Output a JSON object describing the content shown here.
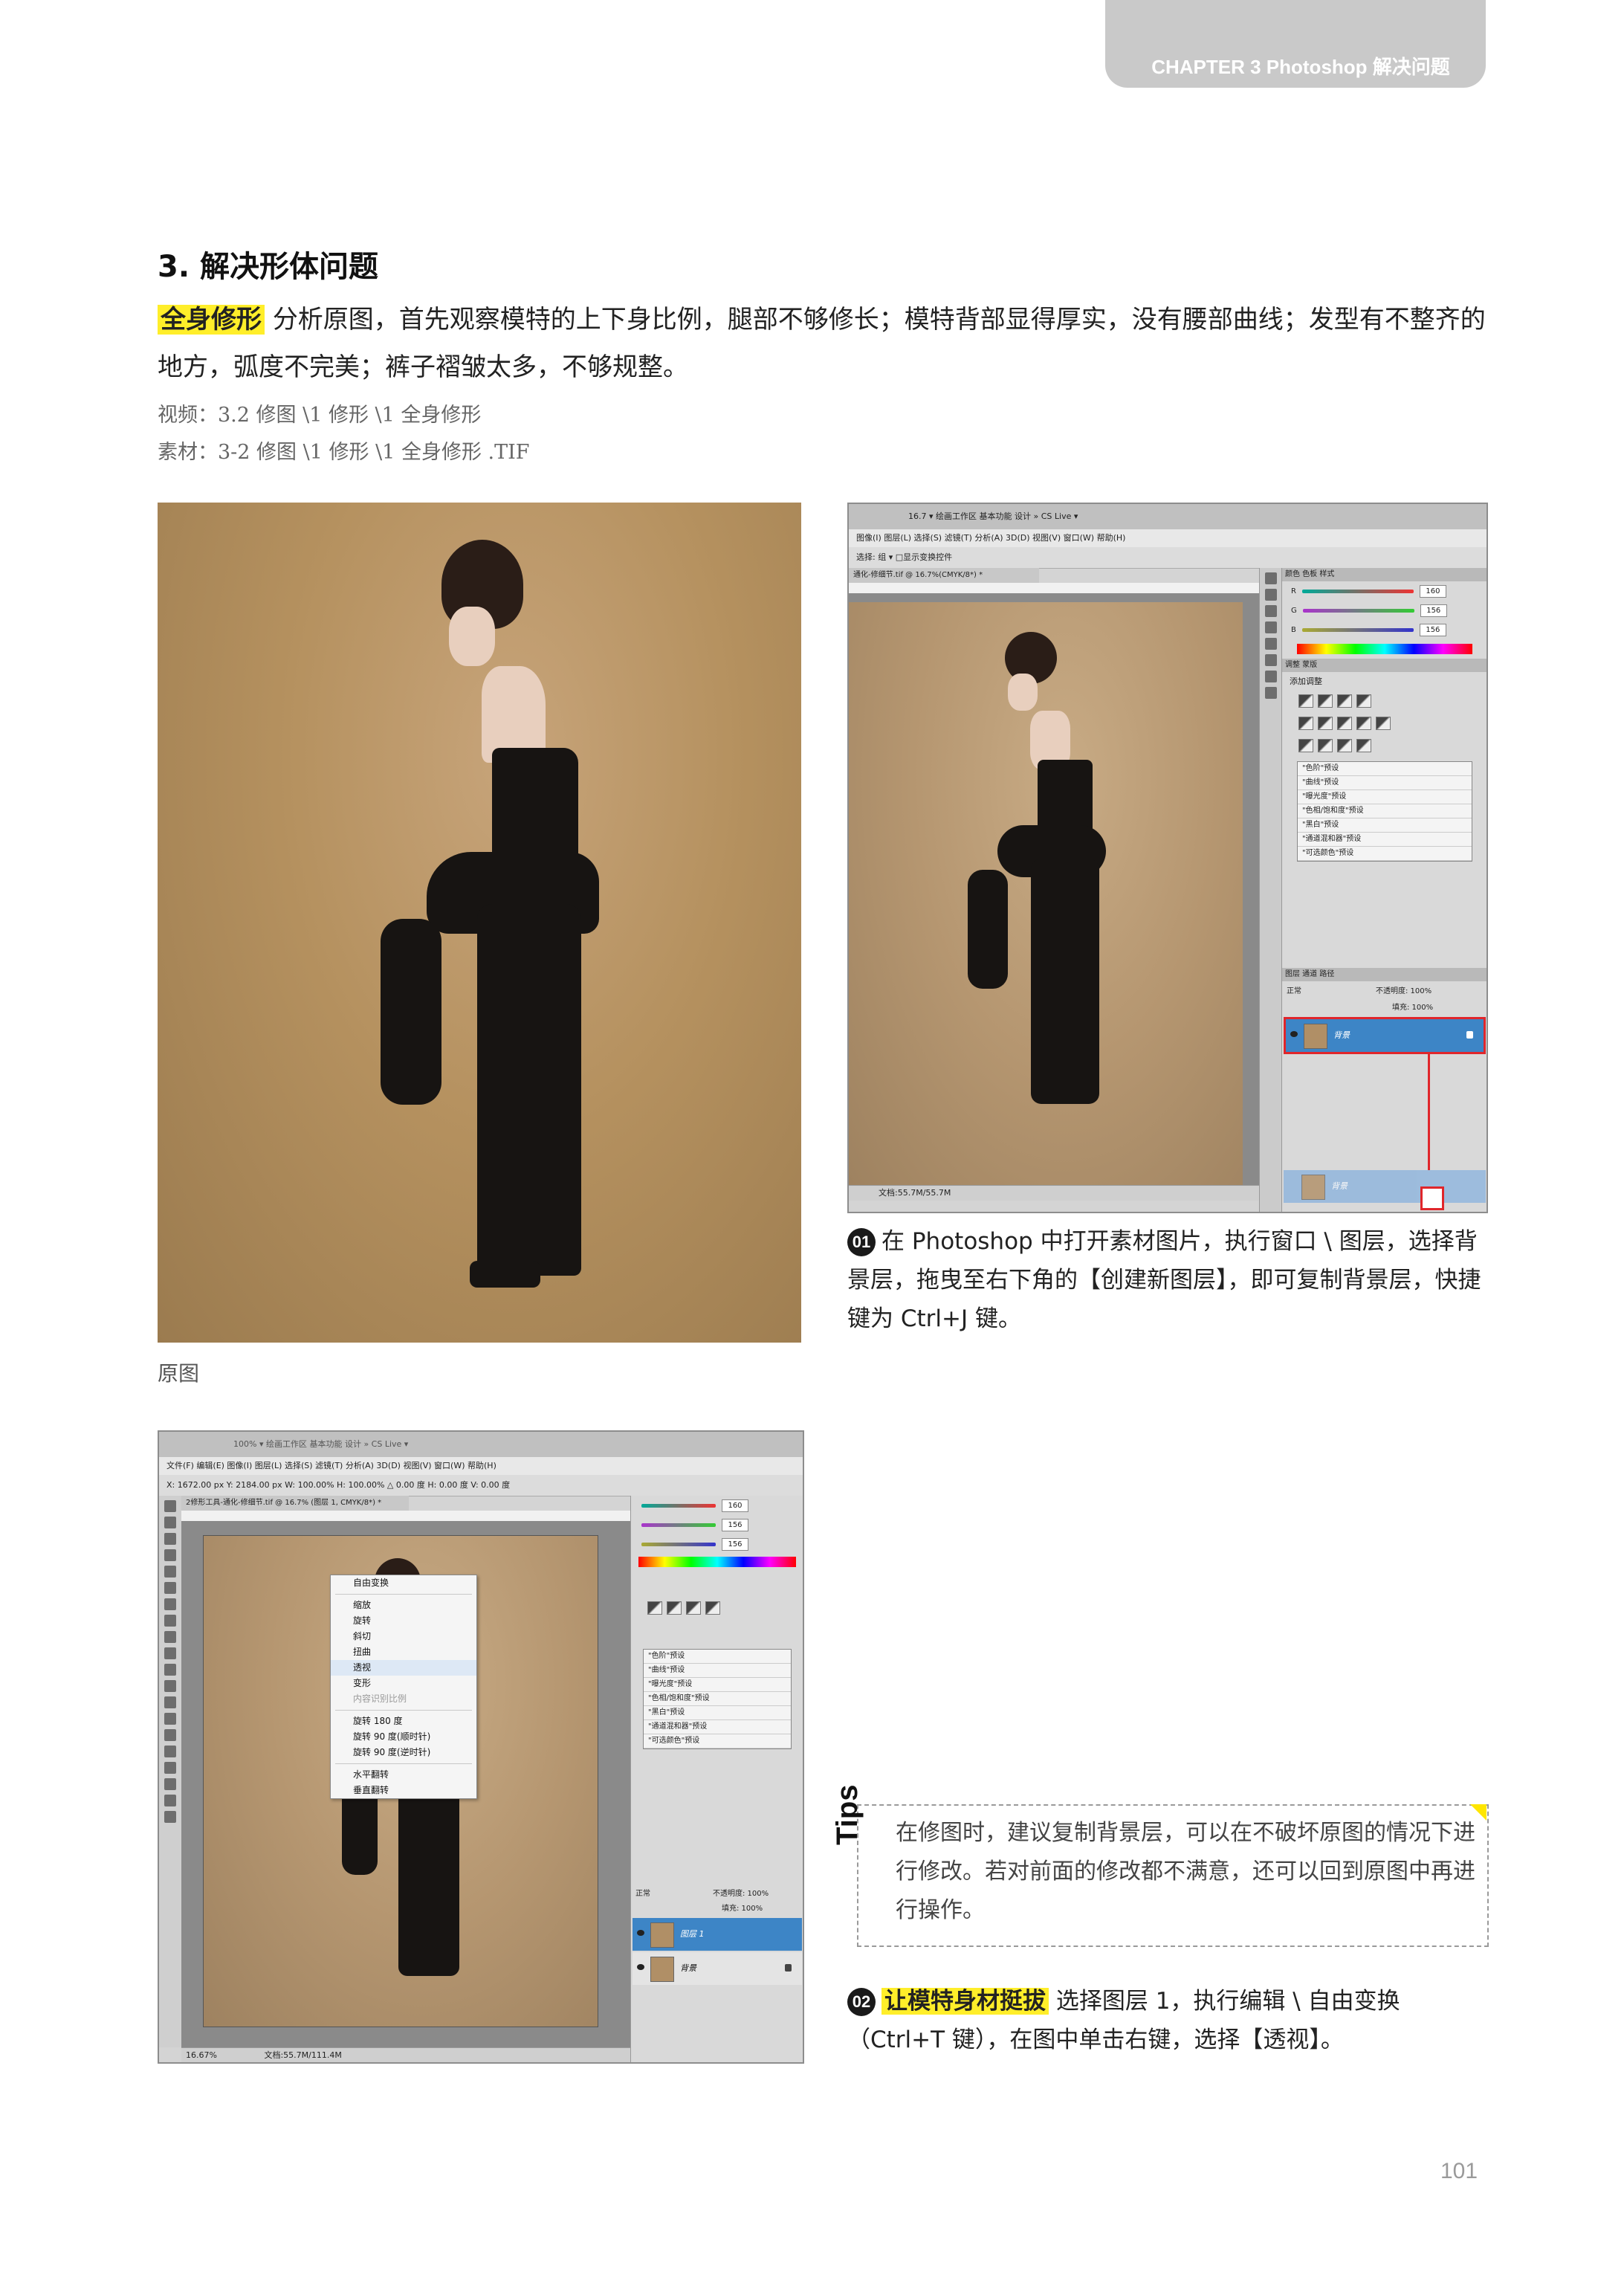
{
  "header": {
    "chapter": "CHAPTER 3  Photoshop 解决问题"
  },
  "section": {
    "title": "3. 解决形体问题"
  },
  "intro": {
    "highlight": "全身修形",
    "text": "分析原图，首先观察模特的上下身比例，腿部不够修长；模特背部显得厚实，没有腰部曲线；发型有不整齐的地方，弧度不完美；裤子褶皱太多，不够规整。"
  },
  "meta": {
    "video": "视频：3.2 修图 \\1 修形 \\1 全身修形",
    "material": "素材：3-2 修图 \\1 修形 \\1 全身修形 .TIF"
  },
  "original": {
    "caption": "原图"
  },
  "step1": {
    "num": "01",
    "text": "在 Photoshop 中打开素材图片，执行窗口 \\ 图层，选择背景层，拖曳至右下角的【创建新图层】，即可复制背景层，快捷键为 Ctrl+J 键。"
  },
  "tips": {
    "label": "Tips",
    "text": "在修图时，建议复制背景层，可以在不破坏原图的情况下进行修改。若对前面的修改都不满意，还可以回到原图中再进行操作。"
  },
  "step2": {
    "num": "02",
    "highlight": "让模特身材挺拔",
    "text": "选择图层 1，执行编辑 \\ 自由变换（Ctrl+T 键），在图中单击右键，选择【透视】。"
  },
  "page_number": "101",
  "ps1": {
    "topbar": "16.7 ▾   绘画工作区   基本功能   设计   »   CS Live ▾",
    "menubar": "图像(I)  图层(L)  选择(S)  滤镜(T)  分析(A)  3D(D)  视图(V)  窗口(W)  帮助(H)",
    "optbar": "选择: 组 ▾   □显示变换控件",
    "doc_tab": "通化-修细节.tif @ 16.7%(CMYK/8*) *",
    "status": "文档:55.7M/55.7M",
    "color_values": [
      "160",
      "156",
      "156"
    ],
    "color_labels": [
      "R",
      "G",
      "B"
    ],
    "adjust_tabs": "调整  蒙版",
    "adjust_title": "添加调整",
    "presets": [
      "\"色阶\"预设",
      "\"曲线\"预设",
      "\"曝光度\"预设",
      "\"色相/饱和度\"预设",
      "\"黑白\"预设",
      "\"通道混和器\"预设",
      "\"可选颜色\"预设"
    ],
    "color_tabs": "颜色  色板  样式",
    "layers_tabs": "图层  通道  路径",
    "blend": "正常",
    "opacity": "不透明度: 100%",
    "fill": "填充: 100%",
    "layer_bg": "背景"
  },
  "ps2": {
    "topbar": "100% ▾        绘画工作区   基本功能   设计   »   CS Live ▾",
    "menubar": "文件(F)  编辑(E)  图像(I)  图层(L)  选择(S)  滤镜(T)  分析(A)  3D(D)  视图(V)  窗口(W)  帮助(H)",
    "optbar": "X: 1672.00 px   Y: 2184.00 px   W: 100.00%   H: 100.00%   △ 0.00 度   H: 0.00 度   V: 0.00 度",
    "doc_tab": "2修形工具-通化-修细节.tif @ 16.7% (图层 1, CMYK/8*) *",
    "status_zoom": "16.67%",
    "status": "文档:55.7M/111.4M",
    "context_menu": {
      "group1": [
        "自由变换"
      ],
      "group2": [
        "缩放",
        "旋转",
        "斜切",
        "扭曲",
        "透视",
        "变形",
        "内容识别比例"
      ],
      "group3": [
        "旋转 180 度",
        "旋转 90 度(顺时针)",
        "旋转 90 度(逆时针)"
      ],
      "group4": [
        "水平翻转",
        "垂直翻转"
      ]
    },
    "color_values": [
      "160",
      "156",
      "156"
    ],
    "presets": [
      "\"色阶\"预设",
      "\"曲线\"预设",
      "\"曝光度\"预设",
      "\"色相/饱和度\"预设",
      "\"黑白\"预设",
      "\"通道混和器\"预设",
      "\"可选颜色\"预设"
    ],
    "blend": "正常",
    "opacity": "不透明度: 100%",
    "fill": "填充: 100%",
    "layer1": "图层 1",
    "layer_bg": "背景"
  },
  "colors": {
    "highlight": "#ffee2a",
    "selection": "#3d85c6",
    "annotation": "#e0262b"
  }
}
